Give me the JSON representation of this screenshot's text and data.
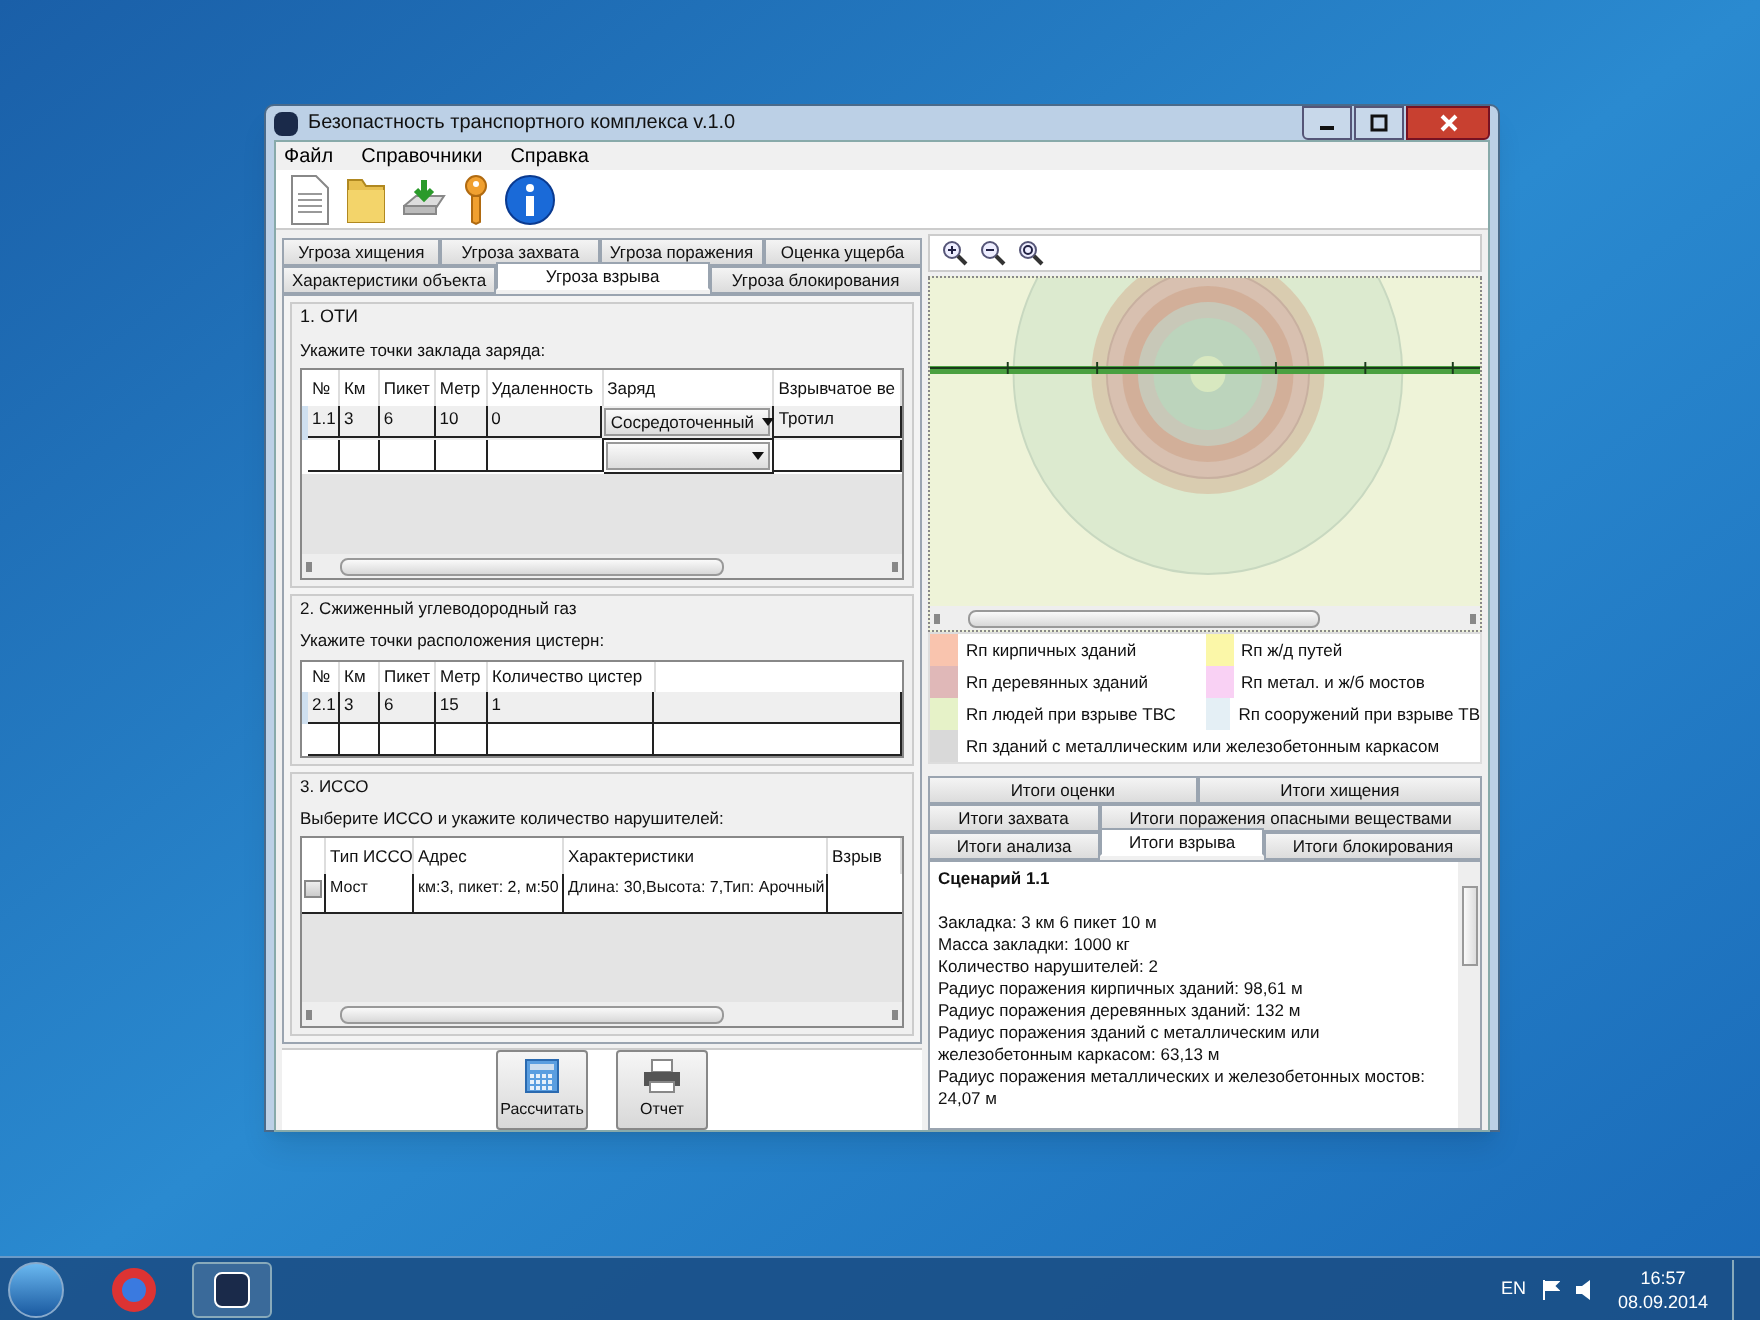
{
  "window": {
    "title": "Безопастность транспортного комплекса v.1.0"
  },
  "menu": [
    "Файл",
    "Справочники",
    "Справка"
  ],
  "toolbar": [
    {
      "kind": "document"
    },
    {
      "kind": "folder"
    },
    {
      "kind": "disk"
    },
    {
      "kind": "key"
    },
    {
      "kind": "info"
    }
  ],
  "tabs_row_1": [
    {
      "label": "Угроза хищения",
      "selected": false
    },
    {
      "label": "Угроза захвата",
      "selected": false
    },
    {
      "label": "Угроза поражения",
      "selected": false
    },
    {
      "label": "Оценка ущерба",
      "selected": false
    }
  ],
  "tabs_row_2": [
    {
      "label": "Характеристики объекта",
      "selected": false
    },
    {
      "label": "Угроза взрыва",
      "selected": true
    },
    {
      "label": "Угроза блокирования",
      "selected": false
    }
  ],
  "oti": {
    "title": "1. ОТИ",
    "instruction": "Укажите точки заклада заряда:",
    "columns": [
      "№",
      "Км",
      "Пикет",
      "Метр",
      "Удаленность",
      "Заряд",
      "Взрывчатое ве"
    ],
    "rows": [
      {
        "no": "1.1",
        "km": "3",
        "piket": "6",
        "metr": "10",
        "distance": "0",
        "charge": "Сосредоточенный",
        "explosive": "Тротил"
      }
    ]
  },
  "gas": {
    "title": "2. Сжиженный углеводородный газ",
    "instruction": "Укажите точки расположения цистерн:",
    "columns": [
      "№",
      "Км",
      "Пикет",
      "Метр",
      "Количество цистер"
    ],
    "rows": [
      {
        "no": "2.1",
        "km": "3",
        "piket": "6",
        "metr": "15",
        "count": "1"
      }
    ]
  },
  "isso": {
    "title": "3. ИССО",
    "instruction": "Выберите ИССО и укажите количество нарушителей:",
    "columns": [
      "Тип ИССО",
      "Адрес",
      "Характеристики",
      "Взрыв"
    ],
    "rows": [
      {
        "checked": false,
        "type": "Мост",
        "address": "км:3, пикет: 2, м:50",
        "specs": "Длина: 30,Высота: 7,Тип: Арочный"
      }
    ]
  },
  "buttons": [
    {
      "label": "Рассчитать",
      "kind": "calculator"
    },
    {
      "label": "Отчет",
      "kind": "printer"
    }
  ],
  "map_tools": [
    {
      "kind": "zoom-in"
    },
    {
      "kind": "zoom-out"
    },
    {
      "kind": "zoom-fit"
    }
  ],
  "legend": [
    {
      "label": "Rп кирпичных зданий",
      "color": "#f9c4ae"
    },
    {
      "label": "Rп ж/д путей",
      "color": "#fbf7a8"
    },
    {
      "label": "Rп деревянных зданий",
      "color": "#e0b8b8"
    },
    {
      "label": "Rп метал. и ж/б мостов",
      "color": "#f9d1f4"
    },
    {
      "label": "Rп людей при взрыве ТВС",
      "color": "#e6f2c8"
    },
    {
      "label": "Rп сооружений при взрыве ТВ",
      "color": "#e4eff5"
    },
    {
      "label": "Rп зданий с металлическим или железобетонным каркасом",
      "color": "#d9d9d9"
    }
  ],
  "result_tabs": [
    [
      {
        "label": "Итоги оценки",
        "selected": false
      },
      {
        "label": "Итоги хищения",
        "selected": false
      }
    ],
    [
      {
        "label": "Итоги захвата",
        "selected": false
      },
      {
        "label": "Итоги поражения опасными веществами",
        "selected": false
      }
    ],
    [
      {
        "label": "Итоги анализа",
        "selected": false
      },
      {
        "label": "Итоги взрыва",
        "selected": true
      },
      {
        "label": "Итоги блокирования",
        "selected": false
      }
    ]
  ],
  "results": {
    "heading": "Сценарий 1.1",
    "lines": [
      "Закладка: 3 км 6 пикет 10 м",
      "Масса закладки: 1000 кг",
      "Количество нарушителей: 2",
      "Радиус поражения кирпичных зданий: 98,61 м",
      "Радиус поражения деревянных зданий: 132 м",
      "Радиус поражения зданий с  металлическим или железобетонным каркасом: 63,13 м",
      "Радиус поражения металлических и железобетонных мостов: 24,07 м"
    ]
  },
  "taskbar": {
    "language": "EN",
    "time": "16:57",
    "date": "08.09.2014"
  }
}
